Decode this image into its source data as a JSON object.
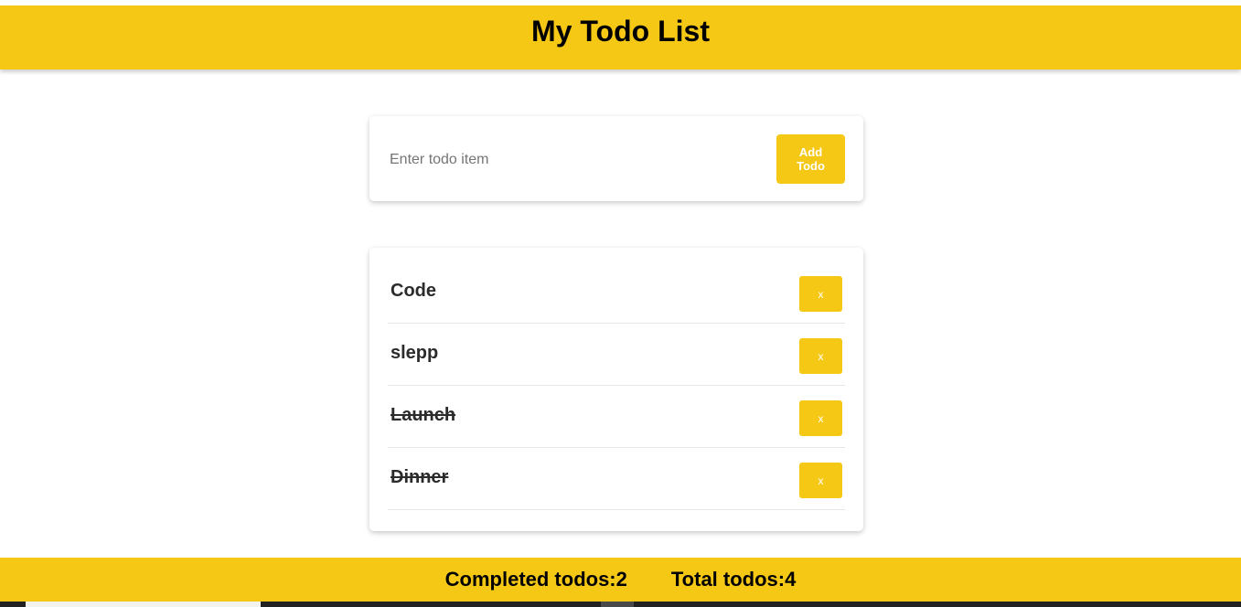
{
  "header": {
    "title": "My Todo List"
  },
  "add_form": {
    "input_placeholder": "Enter todo item",
    "input_value": "",
    "add_button_label": "Add Todo"
  },
  "todos": [
    {
      "text": "Code",
      "completed": false,
      "delete_label": "x"
    },
    {
      "text": "slepp",
      "completed": false,
      "delete_label": "x"
    },
    {
      "text": "Launch",
      "completed": true,
      "delete_label": "x"
    },
    {
      "text": "Dinner",
      "completed": true,
      "delete_label": "x"
    }
  ],
  "footer": {
    "completed_label": "Completed todos:2",
    "total_label": "Total todos:4"
  },
  "colors": {
    "accent": "#f6c816",
    "background": "#ffffff",
    "text": "#000000"
  }
}
